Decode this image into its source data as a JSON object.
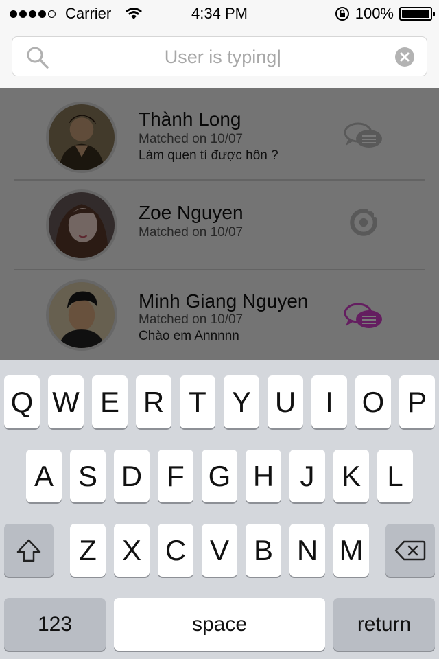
{
  "status_bar": {
    "carrier": "Carrier",
    "time": "4:34 PM",
    "battery": "100%",
    "signal_bars_filled": 4,
    "signal_bars_total": 5
  },
  "search": {
    "value": "User is typing|",
    "placeholder": "User is typing"
  },
  "contacts": [
    {
      "name": "Thành Long",
      "matched": "Matched on 10/07",
      "message": "Làm quen tí được hôn ?",
      "action_icon": "chat-bubbles-icon"
    },
    {
      "name": "Zoe Nguyen",
      "matched": "Matched on 10/07",
      "message": "",
      "action_icon": "target-icon"
    },
    {
      "name": "Minh Giang Nguyen",
      "matched": "Matched on 10/07",
      "message": "Chào em Annnnn",
      "action_icon": "chat-bubbles-purple-icon"
    }
  ],
  "keyboard": {
    "row1": [
      "Q",
      "W",
      "E",
      "R",
      "T",
      "Y",
      "U",
      "I",
      "O",
      "P"
    ],
    "row2": [
      "A",
      "S",
      "D",
      "F",
      "G",
      "H",
      "J",
      "K",
      "L"
    ],
    "row3": [
      "Z",
      "X",
      "C",
      "V",
      "B",
      "N",
      "M"
    ],
    "numbers_label": "123",
    "space_label": "space",
    "return_label": "return"
  },
  "colors": {
    "accent_purple": "#8e1f8a",
    "overlay": "#000000",
    "keyboard_bg": "#d4d7dc"
  }
}
